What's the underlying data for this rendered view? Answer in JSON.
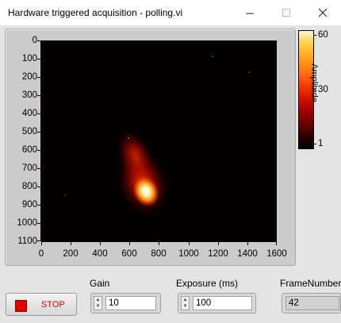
{
  "window": {
    "title": "Hardware triggered acquisition - polling.vi",
    "buttons": [
      "minimize",
      "maximize",
      "close"
    ]
  },
  "graph": {
    "y_ticks": [
      "0",
      "100",
      "200",
      "300",
      "400",
      "500",
      "600",
      "700",
      "800",
      "900",
      "1000",
      "1100"
    ],
    "x_ticks": [
      "0",
      "200",
      "400",
      "600",
      "800",
      "1000",
      "1200",
      "1400",
      "1600"
    ],
    "colors": {
      "background": "#050000",
      "hot": "#ffffff",
      "mid": "#ff3a00",
      "low": "#8a0000"
    }
  },
  "color_scale": {
    "label": "Amplitude",
    "ticks": [
      "60",
      "30",
      "1"
    ]
  },
  "controls": {
    "stop_label": "STOP",
    "gain_label": "Gain",
    "gain_value": "10",
    "exposure_label": "Exposure (ms)",
    "exposure_value": "100",
    "frame_label": "FrameNumber",
    "frame_value": "42"
  },
  "icons": {
    "minimize": "minimize-icon",
    "maximize": "maximize-icon",
    "close": "close-icon",
    "stop": "stop-square-icon",
    "spin_up": "increment-arrow-icon",
    "spin_down": "decrement-arrow-icon"
  }
}
